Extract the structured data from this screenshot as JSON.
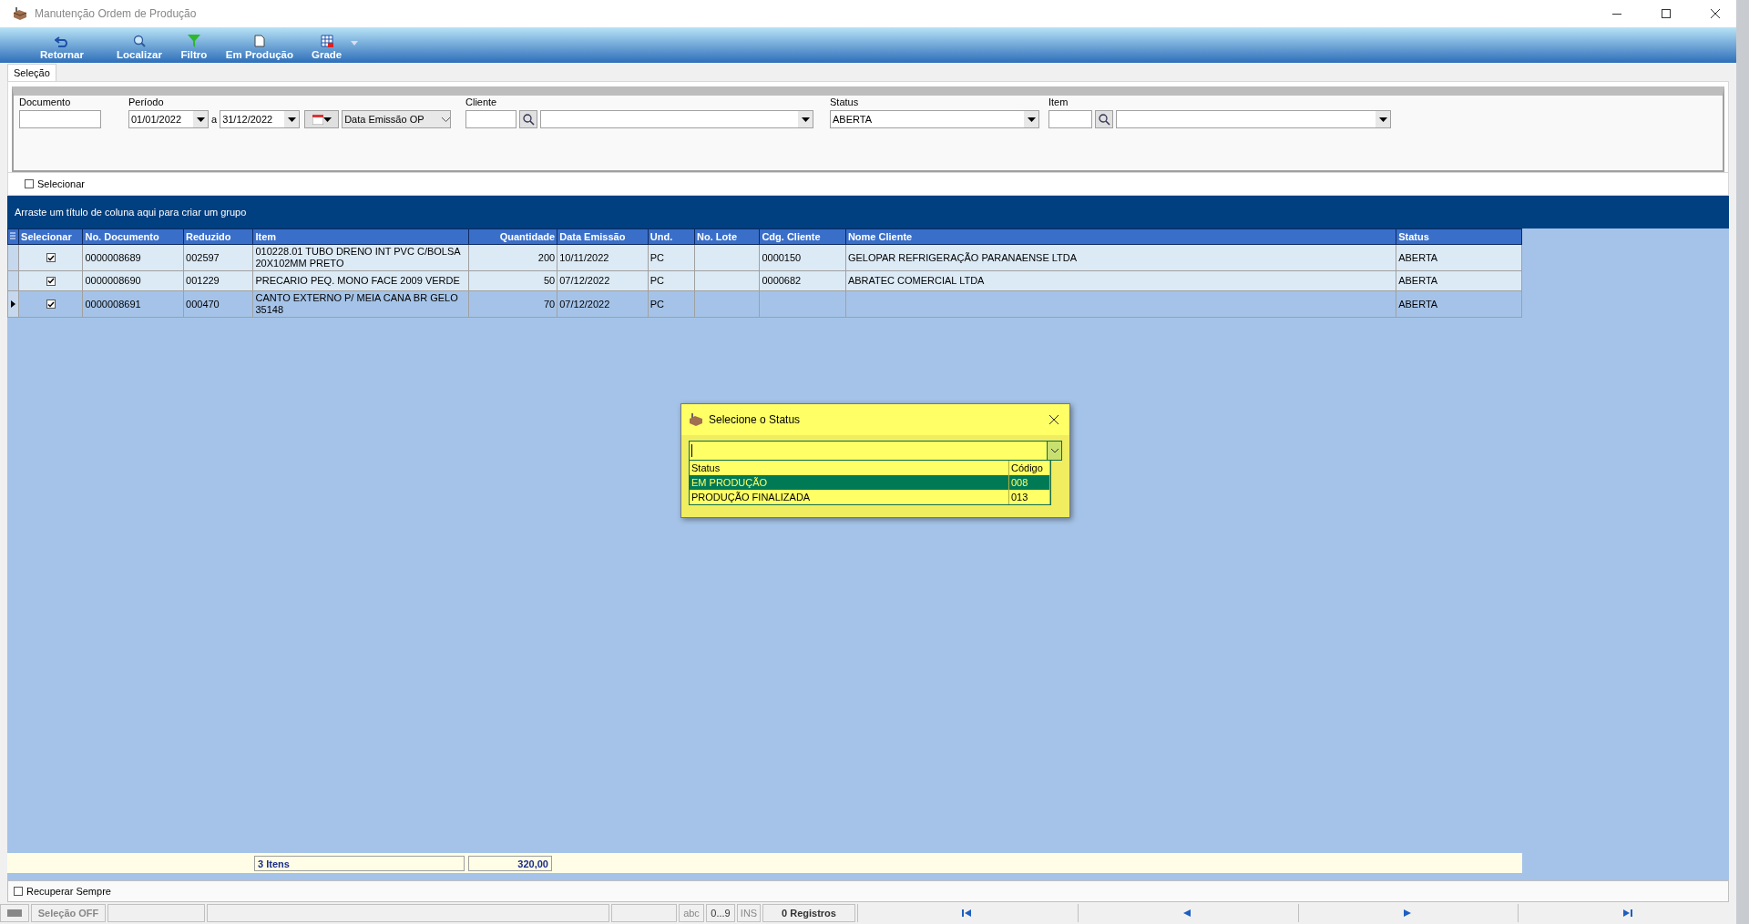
{
  "window": {
    "title": "Manutenção Ordem de Produção"
  },
  "toolbar": [
    {
      "label": "Retornar",
      "kind": "back"
    },
    {
      "label": "Localizar",
      "kind": "search"
    },
    {
      "label": "Filtro",
      "kind": "filter"
    },
    {
      "label": "Em Produção",
      "kind": "doc"
    },
    {
      "label": "Grade",
      "kind": "grid"
    }
  ],
  "tabs": [
    {
      "label": "Seleção",
      "selected": true
    }
  ],
  "filters": {
    "documento": {
      "label": "Documento"
    },
    "periodo": {
      "label": "Período",
      "from": "01/01/2022",
      "separator": "a",
      "to": "31/12/2022",
      "date_type": "Data Emissão OP"
    },
    "cliente": {
      "label": "Cliente"
    },
    "status": {
      "label": "Status",
      "value": "ABERTA"
    },
    "item": {
      "label": "Item"
    }
  },
  "select_all": {
    "label": "Selecionar",
    "checked": false
  },
  "group_hint": "Arraste um título de coluna aqui para criar um grupo",
  "table": {
    "check_column": "Selecionar",
    "columns": [
      "No. Documento",
      "Reduzido",
      "Item",
      "Quantidade",
      "Data Emissão",
      "Und.",
      "No. Lote",
      "Cdg. Cliente",
      "Nome Cliente",
      "Status"
    ],
    "rows": [
      {
        "checked": true,
        "selected": false,
        "cells": [
          "0000008689",
          "002597",
          " 010228.01 TUBO DRENO INT PVC C/BOLSA 20X102MM PRETO",
          "200",
          "10/11/2022",
          "PC",
          "",
          "0000150",
          "GELOPAR REFRIGERAÇÃO PARANAENSE LTDA",
          "ABERTA"
        ]
      },
      {
        "checked": true,
        "selected": false,
        "cells": [
          "0000008690",
          "001229",
          "PRECARIO PEQ. MONO FACE 2009 VERDE",
          "50",
          "07/12/2022",
          "PC",
          "",
          "0000682",
          "ABRATEC COMERCIAL LTDA",
          "ABERTA"
        ]
      },
      {
        "checked": true,
        "selected": true,
        "cells": [
          "0000008691",
          "000470",
          "CANTO EXTERNO P/ MEIA CANA BR GELO 35148",
          "70",
          "07/12/2022",
          "PC",
          "",
          "",
          "",
          "ABERTA"
        ]
      }
    ],
    "footer": {
      "item_count": "3 Itens",
      "quantity_total": "320,00"
    }
  },
  "recuperar": {
    "label": "Recuperar Sempre",
    "checked": false
  },
  "status_bar": {
    "selection": "Seleção OFF",
    "abc": "abc",
    "digits": "0...9",
    "ins": "INS",
    "records": "0 Registros"
  },
  "dialog": {
    "title": "Selecione o Status",
    "columns": [
      "Status",
      "Código"
    ],
    "options": [
      {
        "status": "EM PRODUÇÃO",
        "code": "008",
        "selected": true
      },
      {
        "status": "PRODUÇÃO FINALIZADA",
        "code": "013",
        "selected": false
      }
    ]
  }
}
